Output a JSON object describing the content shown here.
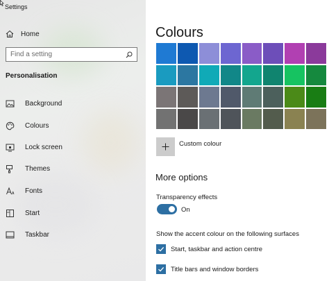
{
  "window": {
    "title": "Settings"
  },
  "sidebar": {
    "home_label": "Home",
    "search_placeholder": "Find a setting",
    "section_title": "Personalisation",
    "items": [
      {
        "label": "Background",
        "icon": "picture-icon"
      },
      {
        "label": "Colours",
        "icon": "palette-icon"
      },
      {
        "label": "Lock screen",
        "icon": "lock-screen-icon"
      },
      {
        "label": "Themes",
        "icon": "brush-icon"
      },
      {
        "label": "Fonts",
        "icon": "font-icon"
      },
      {
        "label": "Start",
        "icon": "start-icon"
      },
      {
        "label": "Taskbar",
        "icon": "taskbar-icon"
      }
    ]
  },
  "main": {
    "title": "Colours",
    "swatches": [
      [
        "#1f7ad3",
        "#0e59b1",
        "#8d8ed8",
        "#6d66d1",
        "#8a5cc7",
        "#6d4eb9",
        "#b140b2",
        "#8b3a9b"
      ],
      [
        "#1a9bc0",
        "#2c77a1",
        "#10aab7",
        "#118788",
        "#13a68e",
        "#10846f",
        "#16c361",
        "#15893e"
      ],
      [
        "#7b7576",
        "#5d5a58",
        "#6d7990",
        "#50596a",
        "#5f7b75",
        "#4c605c",
        "#4b8a18",
        "#197d14"
      ],
      [
        "#727272",
        "#4a4848",
        "#6a7074",
        "#4f545a",
        "#6a7a62",
        "#535c4d",
        "#8a8251",
        "#7c735a"
      ]
    ],
    "custom_colour_label": "Custom colour",
    "more_options_title": "More options",
    "transparency_label": "Transparency effects",
    "transparency_state": "On",
    "accent_surfaces_label": "Show the accent colour on the following surfaces",
    "checkboxes": [
      {
        "label": "Start, taskbar and action centre",
        "checked": true
      },
      {
        "label": "Title bars and window borders",
        "checked": true
      }
    ]
  },
  "colors": {
    "accent": "#2d6fa3",
    "sidebar_bg": "#e8e8e8",
    "main_bg": "#ffffff"
  }
}
